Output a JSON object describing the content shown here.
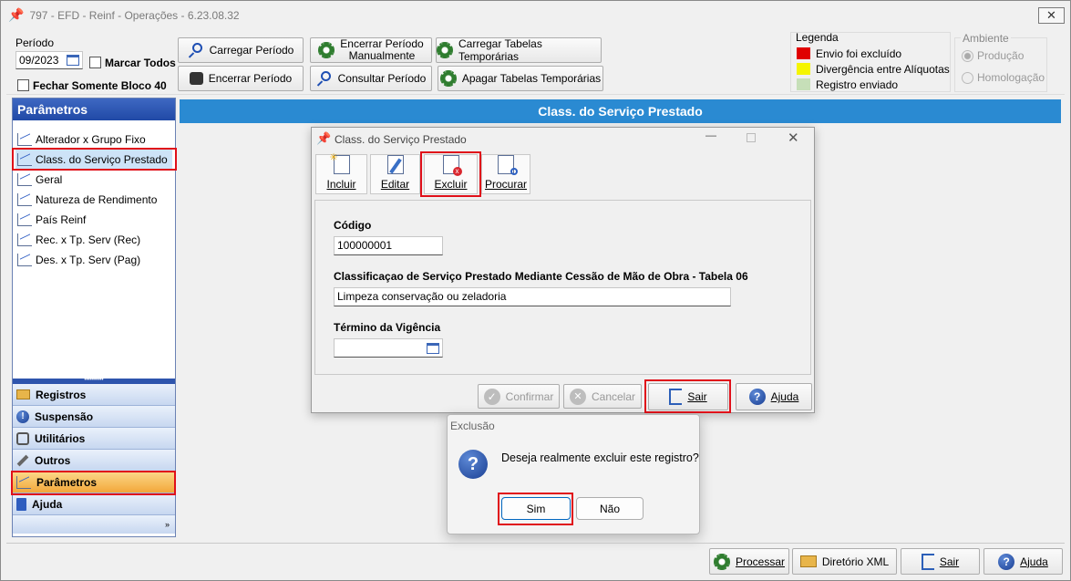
{
  "window": {
    "title": "797 - EFD - Reinf - Operações - 6.23.08.32",
    "close_label": "✕"
  },
  "toolbar": {
    "periodo_label": "Período",
    "periodo_value": "09/2023",
    "marcar_todos": "Marcar Todos",
    "fechar_bloco": "Fechar Somente Bloco 40",
    "carregar_periodo": "Carregar Período",
    "encerrar_periodo": "Encerrar Período",
    "encerrar_manual_1": "Encerrar Período",
    "encerrar_manual_2": "Manualmente",
    "consultar_periodo": "Consultar Período",
    "carregar_tabelas": "Carregar Tabelas Temporárias",
    "apagar_tabelas": "Apagar Tabelas Temporárias"
  },
  "legend": {
    "title": "Legenda",
    "items": [
      {
        "label": "Envio foi excluído",
        "color": "#e00000"
      },
      {
        "label": "Divergência entre Alíquotas",
        "color": "#f5f500"
      },
      {
        "label": "Registro enviado",
        "color": "#c6dfb8"
      }
    ]
  },
  "ambiente": {
    "title": "Ambiente",
    "options": [
      "Produção",
      "Homologação"
    ]
  },
  "sidebar": {
    "header": "Parâmetros",
    "tree": [
      "Alterador x Grupo Fixo",
      "Class. do Serviço Prestado",
      "Geral",
      "Natureza de Rendimento",
      "País Reinf",
      "Rec. x Tp. Serv (Rec)",
      "Des. x Tp. Serv (Pag)"
    ],
    "nav": [
      "Registros",
      "Suspensão",
      "Utilitários",
      "Outros",
      "Parâmetros",
      "Ajuda"
    ]
  },
  "main": {
    "header": "Class. do Serviço Prestado"
  },
  "dialog": {
    "title": "Class. do Serviço Prestado",
    "tools": {
      "incluir": "Incluir",
      "editar": "Editar",
      "excluir": "Excluir",
      "procurar": "Procurar"
    },
    "codigo_label": "Código",
    "codigo_value": "100000001",
    "class_label": "Classificaçao de Serviço Prestado Mediante Cessão de Mão de Obra - Tabela 06",
    "class_value": "Limpeza conservação ou zeladoria",
    "termino_label": "Término da Vigência",
    "confirmar": "Confirmar",
    "cancelar": "Cancelar",
    "sair": "Sair",
    "ajuda": "Ajuda"
  },
  "confirm": {
    "title": "Exclusão",
    "message": "Deseja realmente excluir este registro?",
    "sim": "Sim",
    "nao": "Não"
  },
  "bottom": {
    "processar": "Processar",
    "diretorio": "Diretório XML",
    "sair": "Sair",
    "ajuda": "Ajuda"
  }
}
